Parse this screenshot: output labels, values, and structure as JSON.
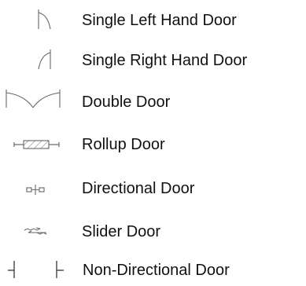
{
  "legend": {
    "items": [
      {
        "icon": "single-left-hand-door-icon",
        "label": "Single Left Hand Door"
      },
      {
        "icon": "single-right-hand-door-icon",
        "label": "Single Right Hand Door"
      },
      {
        "icon": "double-door-icon",
        "label": "Double Door"
      },
      {
        "icon": "rollup-door-icon",
        "label": "Rollup Door"
      },
      {
        "icon": "directional-door-icon",
        "label": "Directional Door"
      },
      {
        "icon": "slider-door-icon",
        "label": "Slider Door"
      },
      {
        "icon": "non-directional-door-icon",
        "label": "Non-Directional Door"
      }
    ]
  },
  "colors": {
    "text": "#111111",
    "symbol_stroke": "#666666",
    "background": "#ffffff"
  }
}
